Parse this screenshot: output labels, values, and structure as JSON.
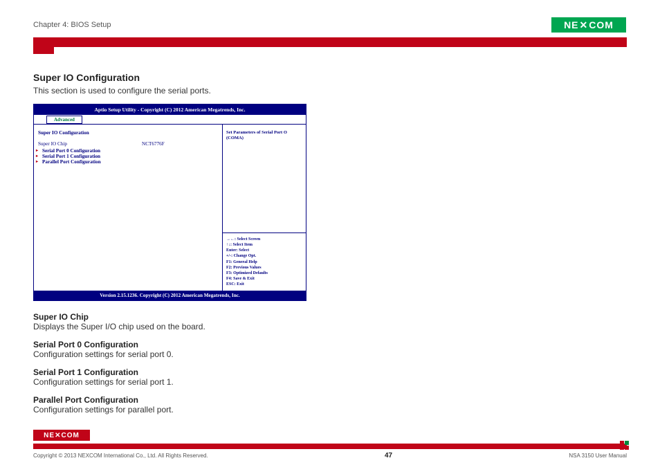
{
  "header": {
    "chapter": "Chapter 4: BIOS Setup",
    "logo_text": "NE COM"
  },
  "section": {
    "title": "Super IO Configuration",
    "desc": "This section is used to configure the serial ports."
  },
  "bios": {
    "title": "Aptio Setup Utility - Copyright (C) 2012 American Megatrends, Inc.",
    "tab": "Advanced",
    "panel_title": "Super IO Configuration",
    "chip_label": "Super IO Chip",
    "chip_value": "NCT6776F",
    "links": {
      "sp0": "Serial Port 0 Configuration",
      "sp1": "Serial Port 1 Configuration",
      "pp": "Parallel Port Configuration"
    },
    "help": "Set Parameters of Serial Port O (COMA)",
    "keys": {
      "k1": "→←: Select Screen",
      "k2": "↑↓: Select Item",
      "k3": "Enter: Select",
      "k4": "+/-: Change Opt.",
      "k5": "F1: General Help",
      "k6": "F2: Previous Values",
      "k7": "F3: Optimized Defaults",
      "k8": "F4: Save & Exit",
      "k9": "ESC: Exit"
    },
    "footer": "Version 2.15.1236. Copyright (C) 2012 American Megatrends, Inc."
  },
  "descriptions": [
    {
      "t": "Super IO Chip",
      "d": "Displays the Super I/O chip used on the board."
    },
    {
      "t": "Serial Port 0 Configuration",
      "d": "Configuration settings for serial port 0."
    },
    {
      "t": "Serial Port 1 Configuration",
      "d": "Configuration settings for serial port 1."
    },
    {
      "t": "Parallel Port Configuration",
      "d": "Configuration settings for parallel port."
    }
  ],
  "footer": {
    "copyright": "Copyright © 2013 NEXCOM International Co., Ltd. All Rights Reserved.",
    "page": "47",
    "manual": "NSA 3150 User Manual",
    "logo_text": "NE COM"
  }
}
